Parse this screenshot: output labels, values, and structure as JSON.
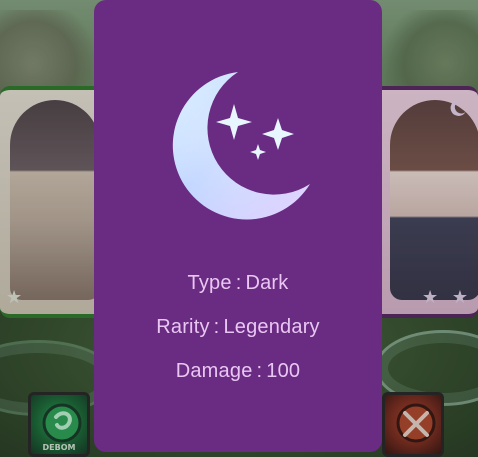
{
  "card": {
    "emblem": {
      "icon": "crescent-moon-with-stars-icon",
      "colors": {
        "moon_light": "#cfe6ff",
        "moon_mid": "#b9c8ff",
        "moon_shadow": "#e6d4ff"
      }
    },
    "stats": [
      {
        "label": "Type",
        "separator": ":",
        "value": "Dark"
      },
      {
        "label": "Rarity",
        "separator": ":",
        "value": "Legendary"
      },
      {
        "label": "Damage",
        "separator": ":",
        "value": "100"
      }
    ],
    "colors": {
      "background": "#6a2b82",
      "text": "#e9c7f2"
    }
  },
  "background_ui": {
    "left_card": {
      "rarity_stars_icon": "star-icon",
      "border_color": "#2f7d2d"
    },
    "right_card": {
      "element_icon": "moon-icon",
      "rarity_stars_icon": "star-icon",
      "border_color": "#5b2b66"
    },
    "bottom_buttons": {
      "left": {
        "icon": "green-orb-icon",
        "label": "DEBOM"
      },
      "right": {
        "icon": "crossed-swords-icon",
        "label": ""
      }
    }
  }
}
